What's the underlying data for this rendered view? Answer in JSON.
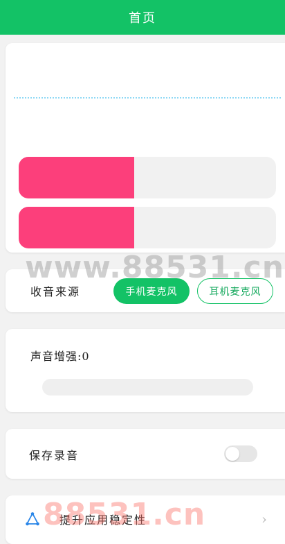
{
  "header": {
    "title": "首页"
  },
  "meters": [
    {
      "level": 0.45
    },
    {
      "level": 0.45
    }
  ],
  "source": {
    "label": "收音来源",
    "options": [
      "手机麦克风",
      "耳机麦克风"
    ],
    "selected": "手机麦克风"
  },
  "enhance": {
    "label": "声音增强:0",
    "value": 0
  },
  "save": {
    "label": "保存录音",
    "enabled": false
  },
  "stability": {
    "label": "提升应用稳定性",
    "icon": "triangle-nodes-icon"
  },
  "watermarks": [
    "www.88531.cn",
    "88531.cn"
  ],
  "colors": {
    "primary": "#13c266",
    "meter_fill": "#fc3f7b",
    "wave": "#8fd9f5",
    "track": "#f1f1f1"
  }
}
